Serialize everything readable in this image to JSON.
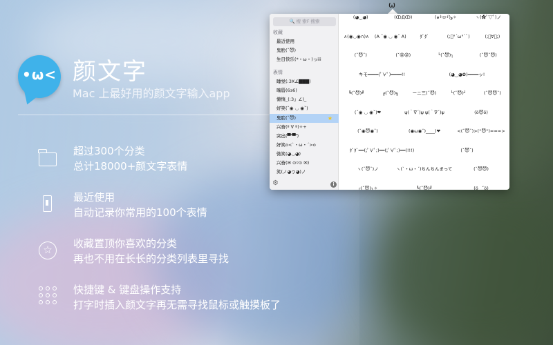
{
  "menubar": {
    "glyph": "ω"
  },
  "app": {
    "icon_face": "•ω<",
    "title": "颜文字",
    "subtitle": "Mac 上最好用的颜文字输入app"
  },
  "features": [
    {
      "icon": "folder-icon",
      "title": "超过300个分类",
      "desc": "总计18000+颜文字表情"
    },
    {
      "icon": "bookmark-icon",
      "title": "最近使用",
      "desc": "自动记录你常用的100个表情"
    },
    {
      "icon": "star-icon",
      "title": "收藏置顶你喜欢的分类",
      "desc": "再也不用在长长的分类列表里寻找"
    },
    {
      "icon": "dots-grid-icon",
      "title": "快捷键 & 键盘操作支持",
      "desc": "打字时插入颜文字再无需寻找鼠标或触摸板了"
    }
  ],
  "popover": {
    "search_placeholder": "搜 索F 搜索",
    "sections": {
      "favorites": "收藏",
      "expressions": "表情"
    },
    "favorites": [
      "最近使用",
      "鬼脸(ˇ😈)",
      "生日快乐(*・ω・)っiii"
    ],
    "categories": [
      "睡觉(:3Х∠▇▇▇)",
      "嘴唇(6з6)",
      "懒惰_(:3」∠)_",
      "好笑(ˇ◉ ◡ ◉ˇ)",
      "鬼脸(ˇ😈)",
      "兴奋(º ∀ º)✧+",
      "突出(▀̿ ̿▀̿ ̿)",
      "好笑o<ˋ・ω・ˊ>o",
      "微笑(◕◡◕)",
      "兴奋(✉ ⊙▿⊙ ✉)",
      "笑(ノ◕ヮ◕)ノ"
    ],
    "selected_index": 4,
    "grid": [
      [
        "(◕‿◕)",
        "(ↀДↀ)",
        "(๑•̀ㅂ•́)و✧",
        "ヽ(✿ﾟ▽ﾟ)ノ"
      ],
      [
        "∧(◉◡◉∩)∧",
        "(A ˇ◉ ◡ ◉ˇ A)",
        "ﾀﾞﾀﾞ",
        "(;ﾞ°´ω°`ﾞ)",
        "(;ﾟ∀ﾟ;)"
      ],
      [
        "(ˇ😈ˇ)",
        "(ˇ😡😡)",
        "└(ˇ😈)┐",
        "(ˇ😈ˇ😈)"
      ],
      [
        "キモ━━━━(ﾟ∀ﾟ)━━━━!!",
        "(◕‿◕✿)━━━━ッ!"
      ],
      [
        "┗(ˇ😈)┛",
        "┏(ˇ😈)┓",
        "ーニ三(ˇ😈)",
        "└(ˇ😈)┘",
        "(ˇ😈😈ˇ)"
      ],
      [
        "(ˇ◉ ◡ ◉ˇ)❤",
        "ψ(｀∇´)ψ ψ(｀∇´)ψ",
        "(ö😈ö)"
      ],
      [
        "(ˇ◉😈◉ˇ)",
        "(◉ω◉ˇ)____)❤",
        "<(ˇ😈ˇ)>(°😈°)≈≈≈>"
      ],
      [
        "ﾀﾞﾀﾞ━━(;ﾟ∀ﾟ;)━━(;ﾟ∀ﾟ;)━━(!!!)",
        "(ˇ😈ˇ)"
      ],
      [
        "ヽ(ˇ😈ˇ)ノ",
        "ヽ(ˋ・ω・ˊ)ちんちんまっていぇ〜",
        "(ˇ😈😈)"
      ],
      [
        "┌(ˇ😈)┐✧",
        "┗(ˇ😈)┛",
        "(ö‿ˇö)"
      ]
    ]
  }
}
